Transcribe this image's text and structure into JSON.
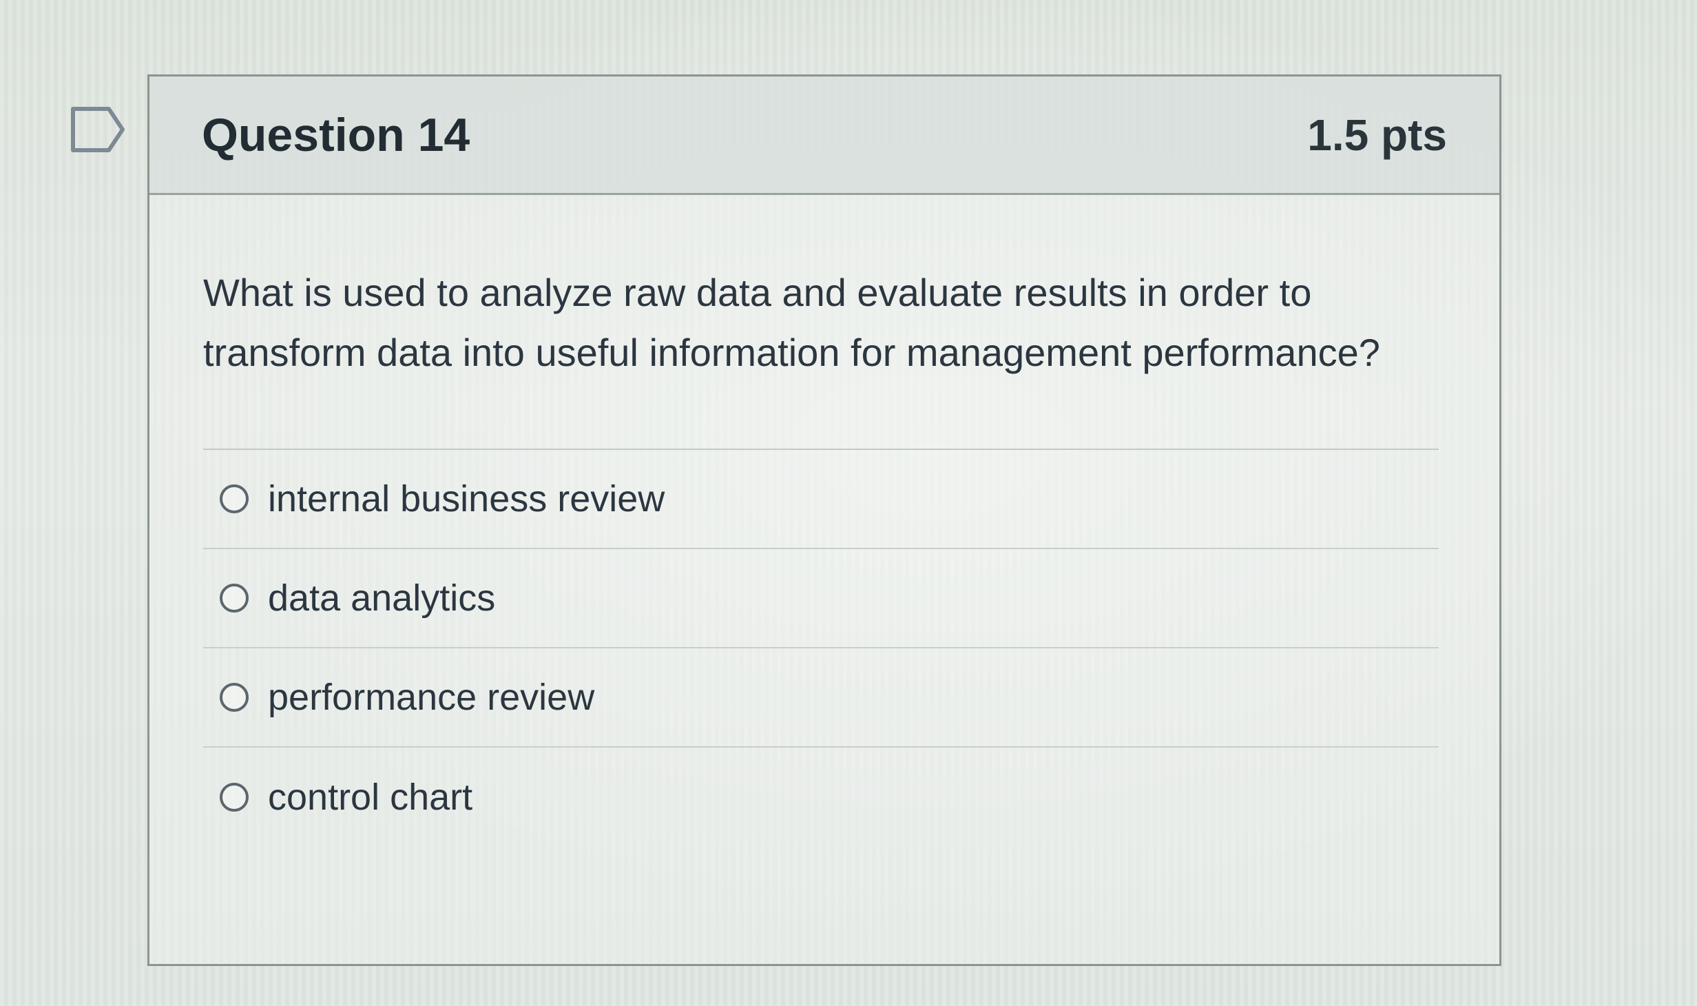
{
  "question": {
    "title": "Question 14",
    "points": "1.5 pts",
    "text": "What is used to analyze raw data and evaluate results in order to transform data into useful information for management performance?",
    "answers": [
      {
        "label": "internal business review"
      },
      {
        "label": "data analytics"
      },
      {
        "label": "performance review"
      },
      {
        "label": "control chart"
      }
    ]
  },
  "icons": {
    "flag": "bookmark-flag-icon"
  },
  "colors": {
    "header_bg": "#d6dcd9",
    "border": "#8c9590",
    "text": "#2b3640"
  }
}
